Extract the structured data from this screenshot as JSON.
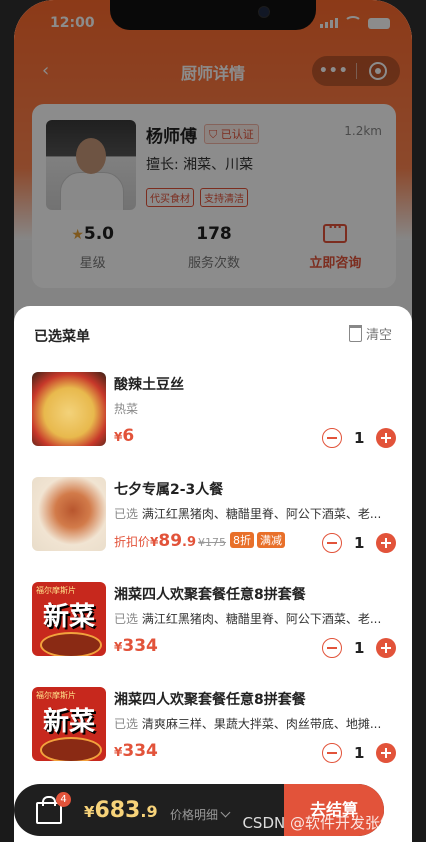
{
  "status": {
    "time": "12:00"
  },
  "nav": {
    "title": "厨师详情",
    "back_icon": "chevron-left-icon"
  },
  "chef": {
    "name": "杨师傅",
    "verified": "已认证",
    "distance": "1.2km",
    "specialty": "擅长: 湘菜、川菜",
    "tags": [
      "代买食材",
      "支持清洁"
    ],
    "rating": "5.0",
    "rating_label": "星级",
    "service_count": "178",
    "service_label": "服务次数",
    "consult_label": "立即咨询"
  },
  "sheet": {
    "title": "已选菜单",
    "clear_label": "清空",
    "items": [
      {
        "name": "酸辣土豆丝",
        "category": "热菜",
        "yen": "¥",
        "price": "6",
        "qty": "1"
      },
      {
        "name": "七夕专属2-3人餐",
        "selected_label": "已选",
        "selected_dishes": "满江红黑猪肉、糖醋里脊、阿公下酒菜、老...",
        "discount_label": "折扣价",
        "yen": "¥",
        "price_int": "89",
        "price_dec": ".9",
        "orig_price": "¥175",
        "badge1": "8折",
        "badge2": "满减",
        "qty": "1"
      },
      {
        "name": "湘菜四人欢聚套餐任意8拼套餐",
        "selected_label": "已选",
        "selected_dishes": "满江红黑猪肉、糖醋里脊、阿公下酒菜、老...",
        "yen": "¥",
        "price": "334",
        "qty": "1"
      },
      {
        "name": "湘菜四人欢聚套餐任意8拼套餐",
        "selected_label": "已选",
        "selected_dishes": "清爽麻三样、果蔬大拌菜、肉丝带底、地摊...",
        "yen": "¥",
        "price": "334",
        "qty": "1"
      }
    ],
    "image_text": {
      "big": "新菜",
      "small": "福尔摩斯片"
    }
  },
  "cart": {
    "count": "4",
    "yen": "¥",
    "total_int": "683",
    "total_dec": ".9",
    "detail_label": "价格明细",
    "checkout_label": "去结算"
  },
  "watermark": "CSDN @软件开发张经理"
}
